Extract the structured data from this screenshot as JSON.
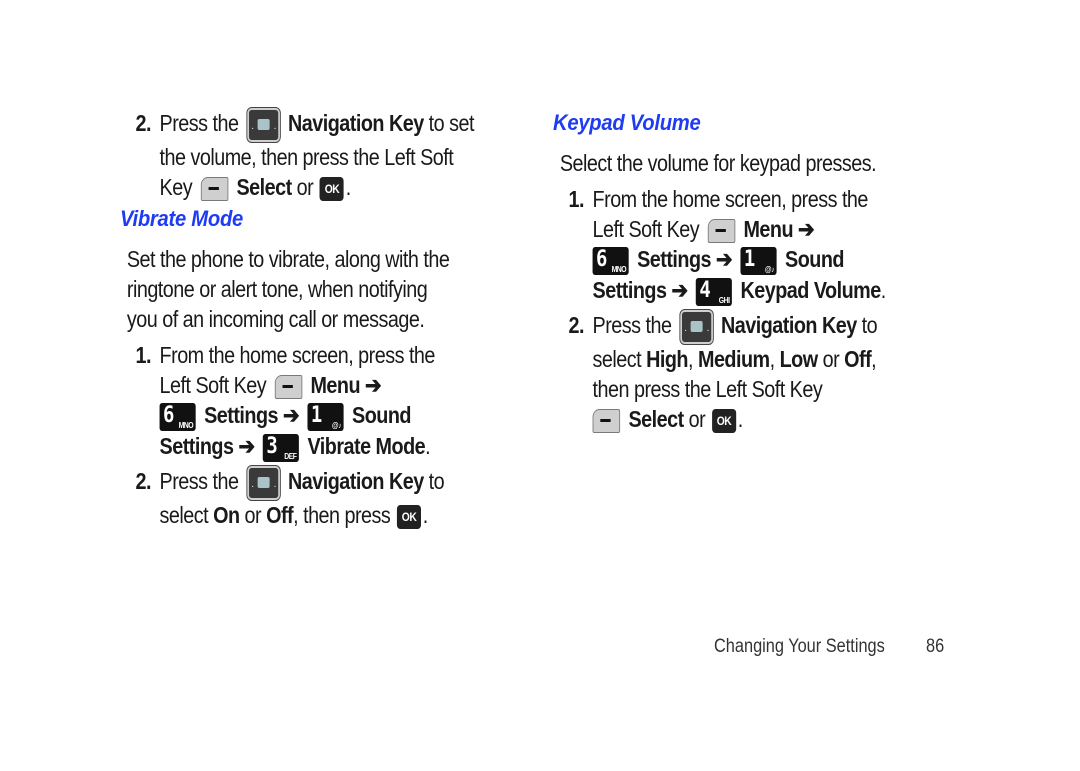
{
  "left": {
    "step2_top": {
      "number": "2.",
      "line1_pre": "Press the",
      "nav_key": "Navigation Key",
      "line1_post": "to set",
      "line2": "the volume, then press the Left Soft",
      "line3_pre": "Key",
      "select": "Select",
      "or": "or",
      "ok": "OK",
      "period": "."
    },
    "vibrate": {
      "heading": "Vibrate Mode",
      "desc": [
        "Set the phone to vibrate, along with the",
        "ringtone or alert tone, when notifying",
        "you of an incoming call or message."
      ],
      "step1": {
        "number": "1.",
        "line1": "From the home screen, press the",
        "line2_pre": "Left Soft Key",
        "menu": "Menu",
        "arrow": "➔",
        "key6": {
          "big": "6",
          "small": "MNO"
        },
        "settings": "Settings",
        "key1": {
          "big": "1",
          "small": "@♪"
        },
        "sound": "Sound",
        "settings2": "Settings",
        "key3": {
          "big": "3",
          "small": "DEF"
        },
        "target": "Vibrate Mode",
        "period": "."
      },
      "step2": {
        "number": "2.",
        "line1_pre": "Press the",
        "nav_key": "Navigation Key",
        "line1_post": "to",
        "line2_pre": "select",
        "on": "On",
        "or": "or",
        "off": "Off",
        "line2_post": ", then press",
        "ok": "OK",
        "period": "."
      }
    }
  },
  "right": {
    "heading": "Keypad Volume",
    "desc": "Select the volume for keypad presses.",
    "step1": {
      "number": "1.",
      "line1": "From the home screen, press the",
      "line2_pre": "Left Soft Key",
      "menu": "Menu",
      "arrow": "➔",
      "key6": {
        "big": "6",
        "small": "MNO"
      },
      "settings": "Settings",
      "key1": {
        "big": "1",
        "small": "@♪"
      },
      "sound": "Sound",
      "settings2": "Settings",
      "key4": {
        "big": "4",
        "small": "GHI"
      },
      "target": "Keypad Volume",
      "period": "."
    },
    "step2": {
      "number": "2.",
      "line1_pre": "Press the",
      "nav_key": "Navigation Key",
      "line1_post": "to",
      "line2_pre": "select",
      "high": "High",
      "medium": "Medium",
      "low": "Low",
      "or": "or",
      "off": "Off",
      "comma": ",",
      "line3": "then press the Left Soft Key",
      "select": "Select",
      "ok": "OK",
      "period": "."
    }
  },
  "footer": {
    "section": "Changing Your Settings",
    "page": "86"
  }
}
